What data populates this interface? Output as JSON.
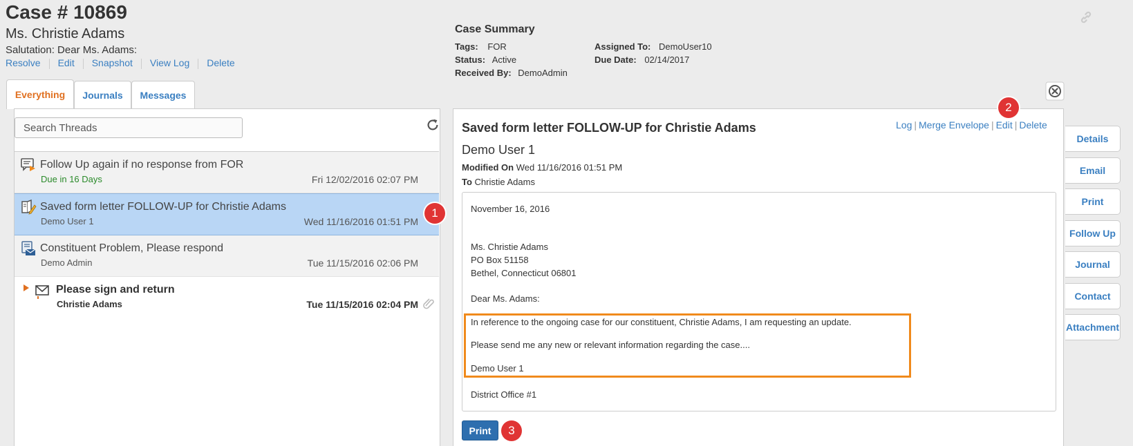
{
  "header": {
    "case_title": "Case # 10869",
    "constituent": "Ms. Christie Adams",
    "salutation": "Salutation: Dear Ms. Adams:",
    "actions": [
      "Resolve",
      "Edit",
      "Snapshot",
      "View Log",
      "Delete"
    ]
  },
  "summary": {
    "title": "Case Summary",
    "tags_label": "Tags:",
    "tags_value": "FOR",
    "status_label": "Status:",
    "status_value": "Active",
    "received_label": "Received By:",
    "received_value": "DemoAdmin",
    "assigned_label": "Assigned To:",
    "assigned_value": "DemoUser10",
    "due_label": "Due Date:",
    "due_value": "02/14/2017"
  },
  "tabs": [
    "Everything",
    "Journals",
    "Messages"
  ],
  "search": {
    "placeholder": "Search Threads"
  },
  "threads": [
    {
      "title": "Follow Up again if no response from FOR",
      "sub": "Due in 16 Days",
      "date": "Fri 12/02/2016 02:07 PM",
      "icon": "follow-up-icon"
    },
    {
      "title": "Saved form letter FOLLOW-UP for Christie Adams",
      "sub": "Demo User 1",
      "date": "Wed 11/16/2016 01:51 PM",
      "icon": "form-letter-icon"
    },
    {
      "title": "Constituent Problem, Please respond",
      "sub": "Demo Admin",
      "date": "Tue 11/15/2016 02:06 PM",
      "icon": "problem-icon"
    },
    {
      "title": "Please sign and return",
      "sub": "Christie Adams",
      "date": "Tue 11/15/2016 02:04 PM",
      "icon": "envelope-icon"
    }
  ],
  "badges": [
    "1",
    "2",
    "3"
  ],
  "detail": {
    "title": "Saved form letter FOLLOW-UP for Christie Adams",
    "actions": [
      "Log",
      "Merge Envelope",
      "Edit",
      "Delete"
    ],
    "separator": "|",
    "author": "Demo User 1",
    "modified_label": "Modified On",
    "modified_value": "Wed 11/16/2016 01:51 PM",
    "to_label": "To",
    "to_value": "Christie Adams",
    "print_label": "Print"
  },
  "letter": {
    "date": "November 16, 2016",
    "name": "Ms. Christie Adams",
    "address1": "PO Box 51158",
    "address2": "Bethel, Connecticut 06801",
    "greeting": "Dear Ms. Adams:",
    "body1": "In reference to the ongoing case for our constituent, Christie Adams, I am requesting an update.",
    "body2": "Please send me any new or relevant information regarding the case....",
    "signature": "Demo User 1",
    "office": "District Office #1"
  },
  "side_tabs": [
    "Details",
    "Email",
    "Print",
    "Follow Up",
    "Journal",
    "Contact",
    "Attachment"
  ],
  "colors": {
    "link": "#3a7fc1",
    "active_tab": "#e07020",
    "selected_row": "#b9d6f5",
    "highlight_border": "#f08a1c",
    "badge": "#e03434",
    "print_button": "#2e6faf",
    "due_text": "#2a8a2a"
  }
}
